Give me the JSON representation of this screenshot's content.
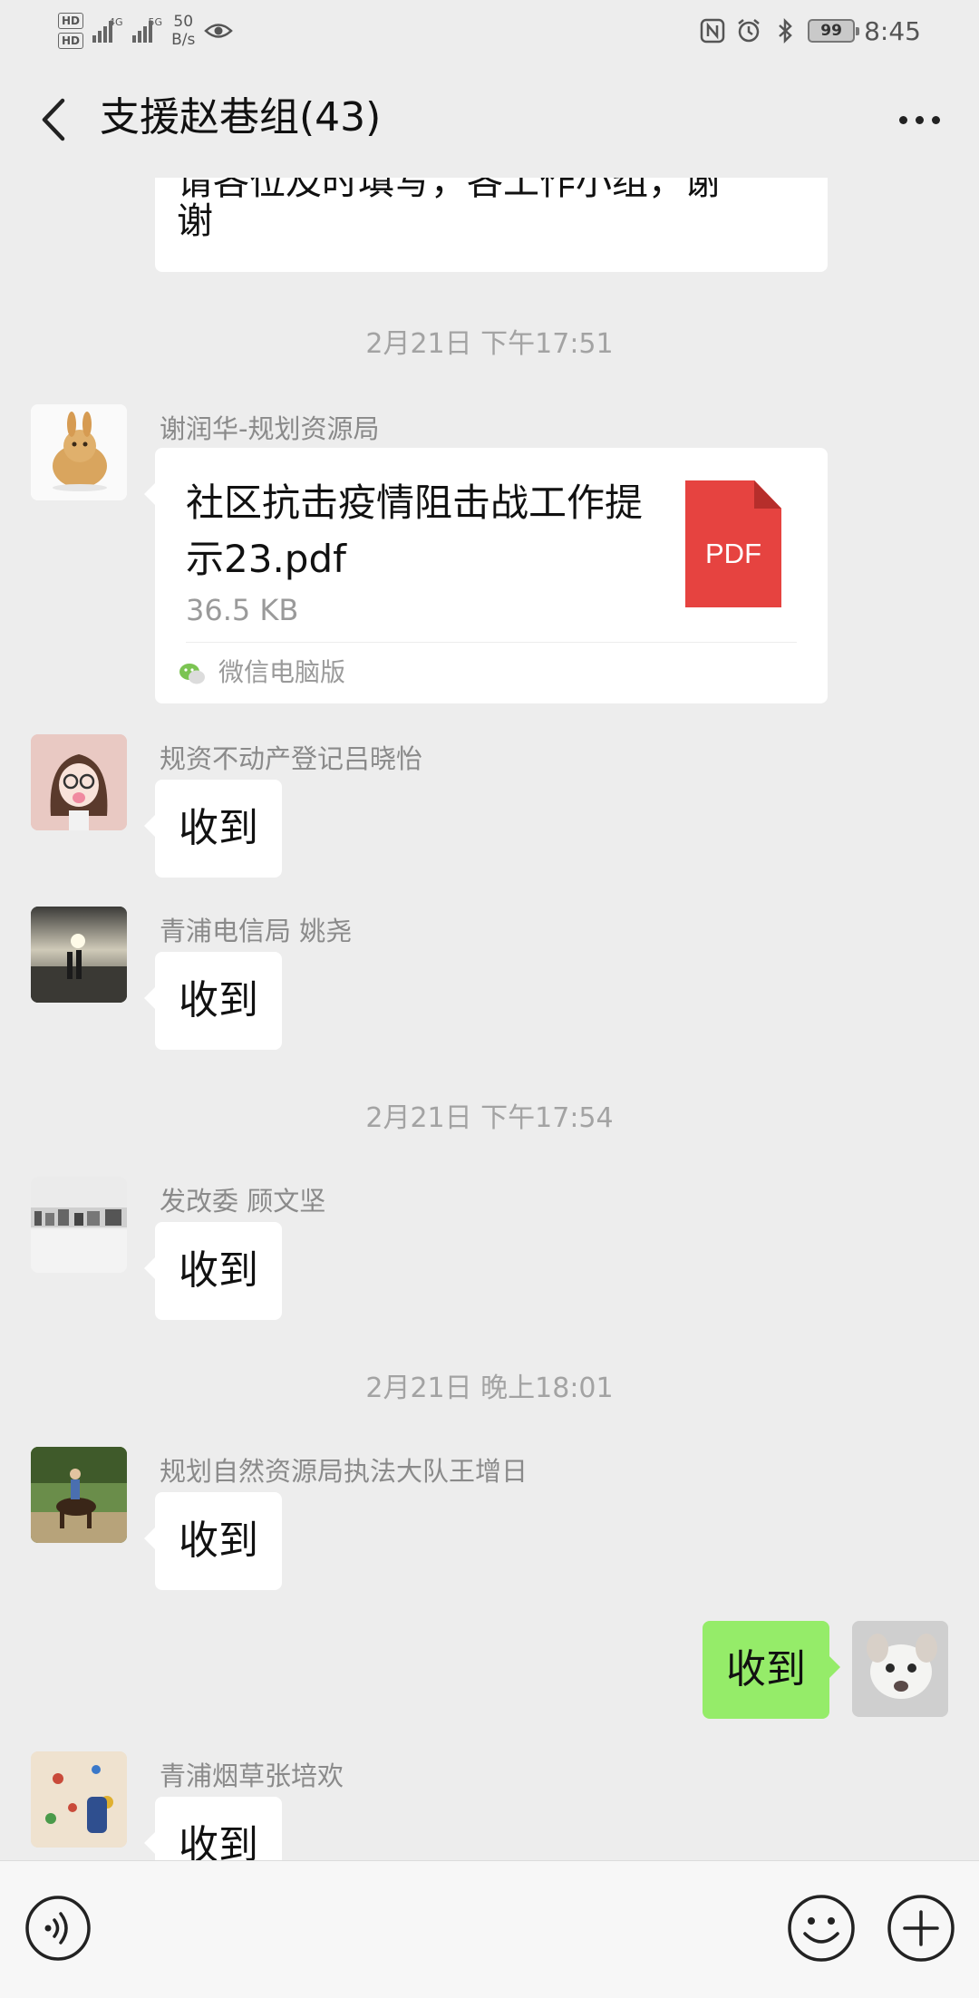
{
  "status_bar": {
    "hd1": "HD",
    "hd2": "HD",
    "net1": "4G",
    "net2": "5G",
    "speed_value": "50",
    "speed_unit": "B/s",
    "battery": "99",
    "time": "8:45"
  },
  "header": {
    "title": "支援赵巷组(43)"
  },
  "messages": {
    "top_partial": {
      "line1": "请各位及时填写，各工作小组，谢",
      "line2": "谢"
    },
    "ts1": "2月21日 下午17:51",
    "m1": {
      "sender": "谢润华-规划资源局",
      "file_name": "社区抗击疫情阻击战工作提示23.pdf",
      "file_size": "36.5 KB",
      "file_type": "PDF",
      "source": "微信电脑版"
    },
    "m2": {
      "sender": "规资不动产登记吕晓怡",
      "text": "收到"
    },
    "m3": {
      "sender": "青浦电信局  姚尧",
      "text": "收到"
    },
    "ts2": "2月21日 下午17:54",
    "m4": {
      "sender": "发改委 顾文坚",
      "text": "收到"
    },
    "ts3": "2月21日 晚上18:01",
    "m5": {
      "sender": "规划自然资源局执法大队王增日",
      "text": "收到"
    },
    "m6_self": {
      "text": "收到"
    },
    "m7": {
      "sender": "青浦烟草张培欢",
      "text": "收到"
    }
  },
  "input_bar": {
    "placeholder": ""
  },
  "icons": {
    "back": "chevron-left-icon",
    "more": "more-dots-icon",
    "voice": "voice-icon",
    "emoji": "emoji-icon",
    "plus": "plus-icon",
    "pdf": "pdf-file-icon"
  },
  "colors": {
    "background": "#ededed",
    "bubble_other": "#ffffff",
    "bubble_self": "#95ec69",
    "pdf_red": "#e64340",
    "meta_gray": "#a3a3a3"
  }
}
